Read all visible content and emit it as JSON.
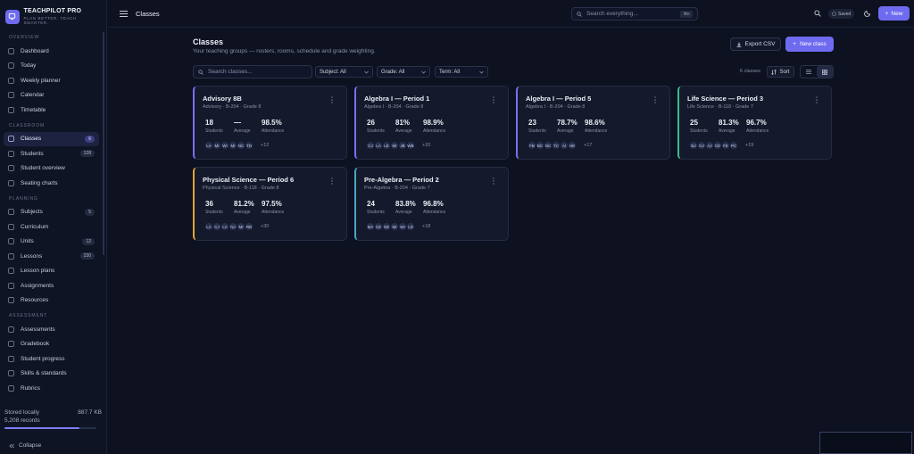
{
  "app": {
    "name": "TEACHPILOT PRO",
    "tagline": "PLAN BETTER. TEACH SMARTER."
  },
  "sidebar": {
    "sections": [
      {
        "label": "OVERVIEW",
        "items": [
          {
            "label": "Dashboard",
            "icon": "grid-icon"
          },
          {
            "label": "Today",
            "icon": "calendar-day-icon"
          },
          {
            "label": "Weekly planner",
            "icon": "calendar-week-icon"
          },
          {
            "label": "Calendar",
            "icon": "calendar-icon"
          },
          {
            "label": "Timetable",
            "icon": "table-icon"
          }
        ]
      },
      {
        "label": "CLASSROOM",
        "items": [
          {
            "label": "Classes",
            "icon": "book-icon",
            "badge": "6",
            "active": true
          },
          {
            "label": "Students",
            "icon": "users-icon",
            "badge": "128"
          },
          {
            "label": "Student overview",
            "icon": "user-icon"
          },
          {
            "label": "Seating charts",
            "icon": "seat-icon"
          }
        ]
      },
      {
        "label": "PLANNING",
        "items": [
          {
            "label": "Subjects",
            "icon": "layers-icon",
            "badge": "5"
          },
          {
            "label": "Curriculum",
            "icon": "map-icon"
          },
          {
            "label": "Units",
            "icon": "stack-icon",
            "badge": "12"
          },
          {
            "label": "Lessons",
            "icon": "file-icon",
            "badge": "230"
          },
          {
            "label": "Lesson plans",
            "icon": "clipboard-icon"
          },
          {
            "label": "Assignments",
            "icon": "edit-icon"
          },
          {
            "label": "Resources",
            "icon": "folder-icon"
          }
        ]
      },
      {
        "label": "ASSESSMENT",
        "items": [
          {
            "label": "Assessments",
            "icon": "check-icon"
          },
          {
            "label": "Gradebook",
            "icon": "gradebook-icon"
          },
          {
            "label": "Student progress",
            "icon": "trend-icon"
          },
          {
            "label": "Skills & standards",
            "icon": "target-icon"
          },
          {
            "label": "Rubrics",
            "icon": "star-icon"
          }
        ]
      }
    ],
    "storage": {
      "label": "Stored locally",
      "size": "887.7 KB",
      "records": "5,208 records",
      "usage_fraction": 0.82
    },
    "collapse_label": "Collapse"
  },
  "topbar": {
    "title": "Classes",
    "search_placeholder": "Search everything...",
    "search_shortcut": "⌘K",
    "saved_label": "Saved",
    "new_label": "New"
  },
  "page": {
    "title": "Classes",
    "subtitle": "Your teaching groups — rosters, rooms, schedule and grade weighting.",
    "export_label": "Export CSV",
    "new_class_label": "New class",
    "search_placeholder": "Search classes...",
    "filters": [
      "Subject: All",
      "Grade: All",
      "Term: All"
    ],
    "count_label": "6 classes",
    "sort_label": "Sort"
  },
  "stat_labels": {
    "students": "Students",
    "average": "Average",
    "attendance": "Attendance"
  },
  "classes": [
    {
      "title": "Advisory 8B",
      "meta": "Advisory · B-204 · Grade 8",
      "accent": "#7c6ff2",
      "students": "18",
      "average": "—",
      "attendance": "98.5%",
      "chips": [
        "LA",
        "MI",
        "WI",
        "MI",
        "NC",
        "TD"
      ],
      "more": "+12"
    },
    {
      "title": "Algebra I — Period 1",
      "meta": "Algebra I · B-204 · Grade 8",
      "accent": "#7c6ff2",
      "students": "26",
      "average": "81%",
      "attendance": "98.9%",
      "chips": [
        "CJ",
        "LA",
        "LE",
        "MI",
        "JB",
        "WB"
      ],
      "more": "+20"
    },
    {
      "title": "Algebra I — Period 5",
      "meta": "Algebra I · B-204 · Grade 8",
      "accent": "#7c6ff2",
      "students": "23",
      "average": "78.7%",
      "attendance": "98.6%",
      "chips": [
        "FB",
        "BC",
        "NC",
        "TC",
        "AI",
        "HE"
      ],
      "more": "+17"
    },
    {
      "title": "Life Science — Period 3",
      "meta": "Life Science · B-118 · Grade 7",
      "accent": "#3fb98e",
      "students": "25",
      "average": "81.3%",
      "attendance": "96.7%",
      "chips": [
        "BJ",
        "OJ",
        "AJ",
        "CE",
        "FE",
        "PC"
      ],
      "more": "+19"
    },
    {
      "title": "Physical Science — Period 6",
      "meta": "Physical Science · B-118 · Grade 8",
      "accent": "#e0a530",
      "students": "36",
      "average": "81.2%",
      "attendance": "97.5%",
      "chips": [
        "LA",
        "CJ",
        "LA",
        "NJ",
        "MI",
        "RB"
      ],
      "more": "+30"
    },
    {
      "title": "Pre-Algebra — Period 2",
      "meta": "Pre-Algebra · B-204 · Grade 7",
      "accent": "#4aa6c8",
      "students": "24",
      "average": "83.8%",
      "attendance": "96.8%",
      "chips": [
        "MA",
        "CE",
        "GE",
        "MI",
        "WI",
        "LD"
      ],
      "more": "+18"
    }
  ]
}
